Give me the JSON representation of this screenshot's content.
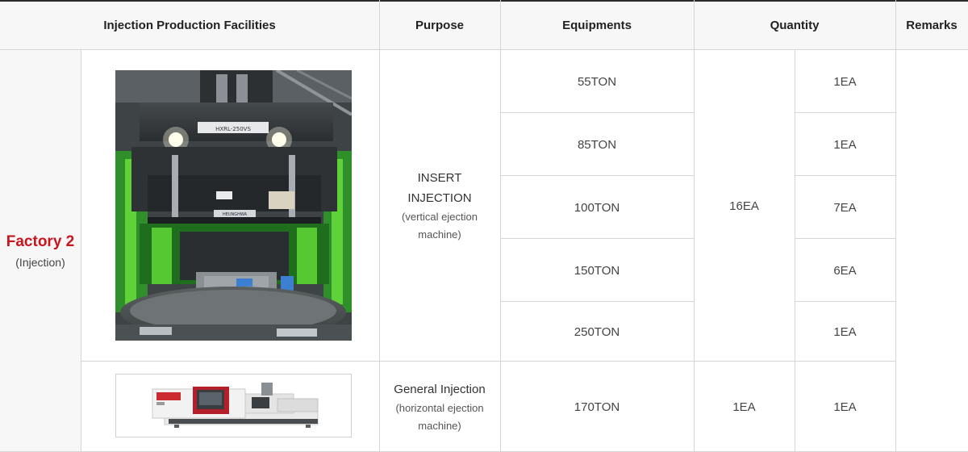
{
  "header": {
    "facilities": "Injection Production Facilities",
    "purpose": "Purpose",
    "equipments": "Equipments",
    "quantity": "Quantity",
    "remarks": "Remarks"
  },
  "factory": {
    "name": "Factory 2",
    "sub": "(Injection)",
    "accent": "#c8161d"
  },
  "groups": [
    {
      "purpose_lines": [
        "INSERT",
        "INJECTION"
      ],
      "purpose_detail": [
        "(vertical ejection",
        "machine)"
      ],
      "total": "16EA",
      "equipments": [
        {
          "name": "55TON",
          "qty": "1EA"
        },
        {
          "name": "85TON",
          "qty": "1EA"
        },
        {
          "name": "100TON",
          "qty": "7EA"
        },
        {
          "name": "150TON",
          "qty": "6EA"
        },
        {
          "name": "250TON",
          "qty": "1EA"
        }
      ]
    },
    {
      "purpose_lines": [
        "General Injection"
      ],
      "purpose_detail": [
        "(horizontal ejection",
        "machine)"
      ],
      "total": "1EA",
      "equipments": [
        {
          "name": "170TON",
          "qty": "1EA"
        }
      ]
    }
  ],
  "photos": {
    "vertical_machine_label": "HXRL-250VS",
    "vertical_brand_label": "HEUNGHWA"
  }
}
